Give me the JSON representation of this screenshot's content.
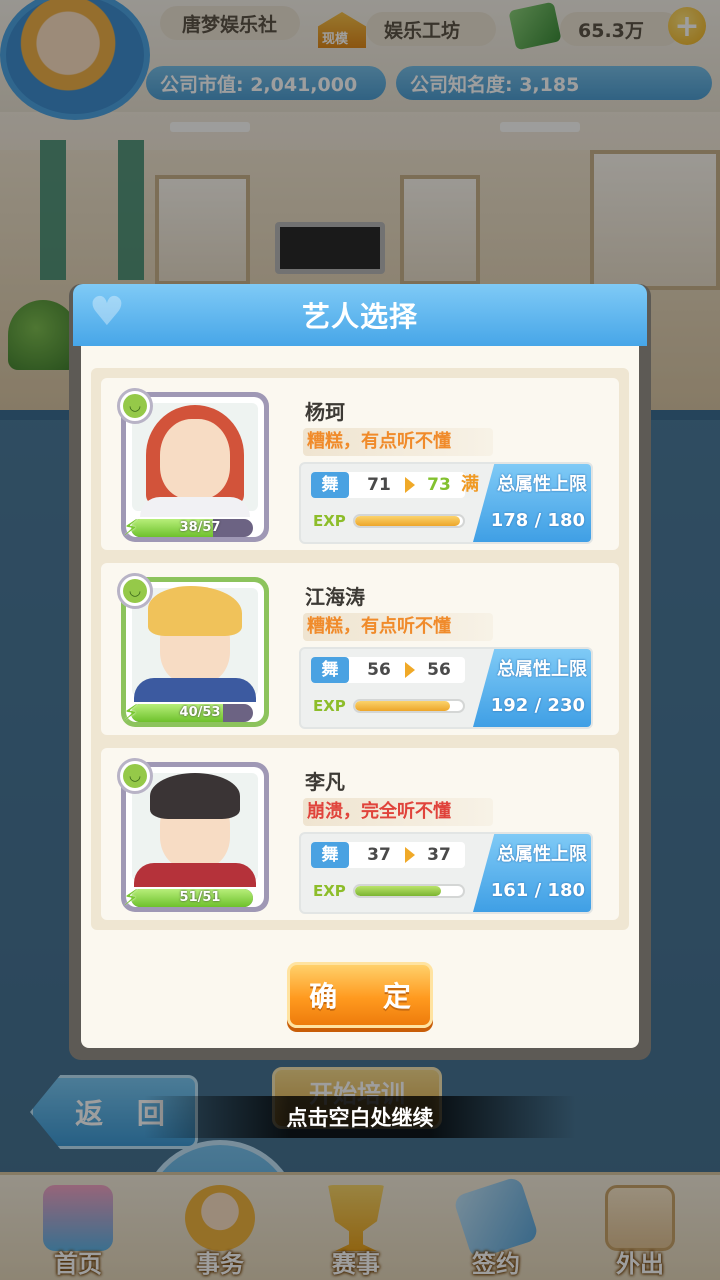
{
  "hud": {
    "company_name": "唐梦娱乐社",
    "rank_badge": "现模",
    "company_type": "娱乐工坊",
    "money": "65.3万",
    "market_value": "公司市值: 2,041,000",
    "fame": "公司知名度: 3,185",
    "plus_icon": "+"
  },
  "dialog": {
    "title": "艺人选择",
    "confirm_label": "确 定"
  },
  "artists": [
    {
      "name": "杨珂",
      "comment": "糟糕，有点听不懂",
      "comment_color": "#f08b2b",
      "energy": "38/57",
      "energy_fraction": 0.67,
      "skill": "舞",
      "stat_from": "71",
      "stat_to": "73",
      "max_tag": "满",
      "limit_label": "总属性上限",
      "exp_label": "EXP",
      "exp_fraction": 0.97,
      "total": "178 / 180"
    },
    {
      "name": "江海涛",
      "comment": "糟糕，有点听不懂",
      "comment_color": "#f08b2b",
      "energy": "40/53",
      "energy_fraction": 0.75,
      "skill": "舞",
      "stat_from": "56",
      "stat_to": "56",
      "max_tag": "",
      "limit_label": "总属性上限",
      "exp_label": "EXP",
      "exp_fraction": 0.88,
      "total": "192 / 230"
    },
    {
      "name": "李凡",
      "comment": "崩溃，完全听不懂",
      "comment_color": "#e0433b",
      "energy": "51/51",
      "energy_fraction": 1.0,
      "skill": "舞",
      "stat_from": "37",
      "stat_to": "37",
      "max_tag": "",
      "limit_label": "总属性上限",
      "exp_label": "EXP",
      "exp_fraction": 0.8,
      "total": "161 / 180"
    }
  ],
  "background": {
    "back_button": "返 回",
    "start_training": "开始培训",
    "continue_hint": "点击空白处继续"
  },
  "nav": {
    "items": [
      {
        "label": "首页",
        "icon": "home-icon"
      },
      {
        "label": "事务",
        "icon": "affairs-icon"
      },
      {
        "label": "赛事",
        "icon": "trophy-icon"
      },
      {
        "label": "签约",
        "icon": "contract-icon"
      },
      {
        "label": "外出",
        "icon": "exit-door-icon"
      }
    ]
  },
  "colors": {
    "header_blue": "#47a6e8",
    "confirm_orange": "#ff9a1f",
    "exp_orange": "#eda62a",
    "exp_green": "#7cb532"
  }
}
